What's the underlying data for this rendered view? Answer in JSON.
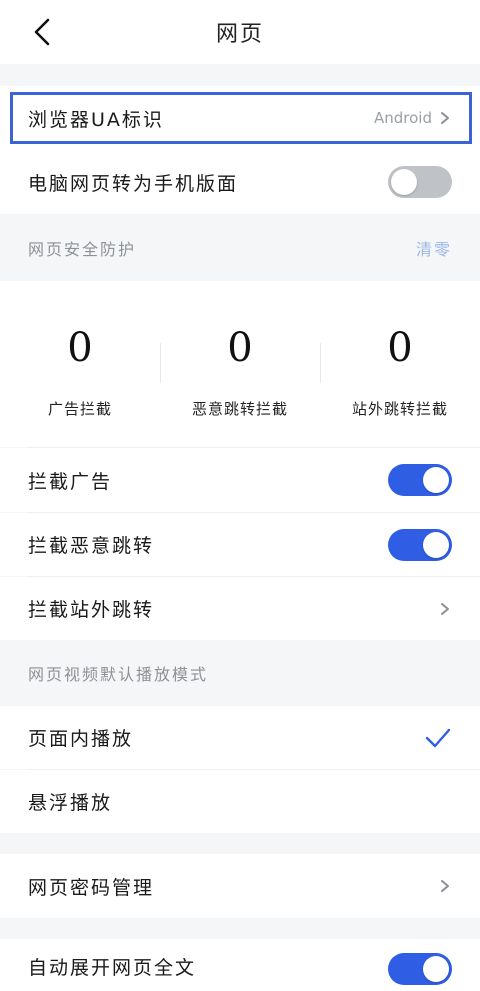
{
  "header": {
    "title": "网页"
  },
  "rows": {
    "ua": {
      "label": "浏览器UA标识",
      "value": "Android"
    },
    "pc_to_mobile": {
      "label": "电脑网页转为手机版面",
      "toggle": "off"
    },
    "block_ads": {
      "label": "拦截广告",
      "toggle": "on"
    },
    "block_malicious": {
      "label": "拦截恶意跳转",
      "toggle": "on"
    },
    "block_offsite": {
      "label": "拦截站外跳转"
    },
    "inline_play": {
      "label": "页面内播放",
      "selected": true
    },
    "float_play": {
      "label": "悬浮播放"
    },
    "password_mgmt": {
      "label": "网页密码管理"
    },
    "auto_expand": {
      "label": "自动展开网页全文",
      "toggle": "on"
    }
  },
  "sections": {
    "security": {
      "title": "网页安全防护",
      "action": "清零"
    },
    "video": {
      "title": "网页视频默认播放模式"
    }
  },
  "stats": [
    {
      "value": "0",
      "label": "广告拦截"
    },
    {
      "value": "0",
      "label": "恶意跳转拦截"
    },
    {
      "value": "0",
      "label": "站外跳转拦截"
    }
  ],
  "colors": {
    "accent": "#2f5ee5",
    "toggle_off": "#bfc2c7",
    "highlight": "#3b63d3",
    "section_action": "#9bb7e6"
  }
}
